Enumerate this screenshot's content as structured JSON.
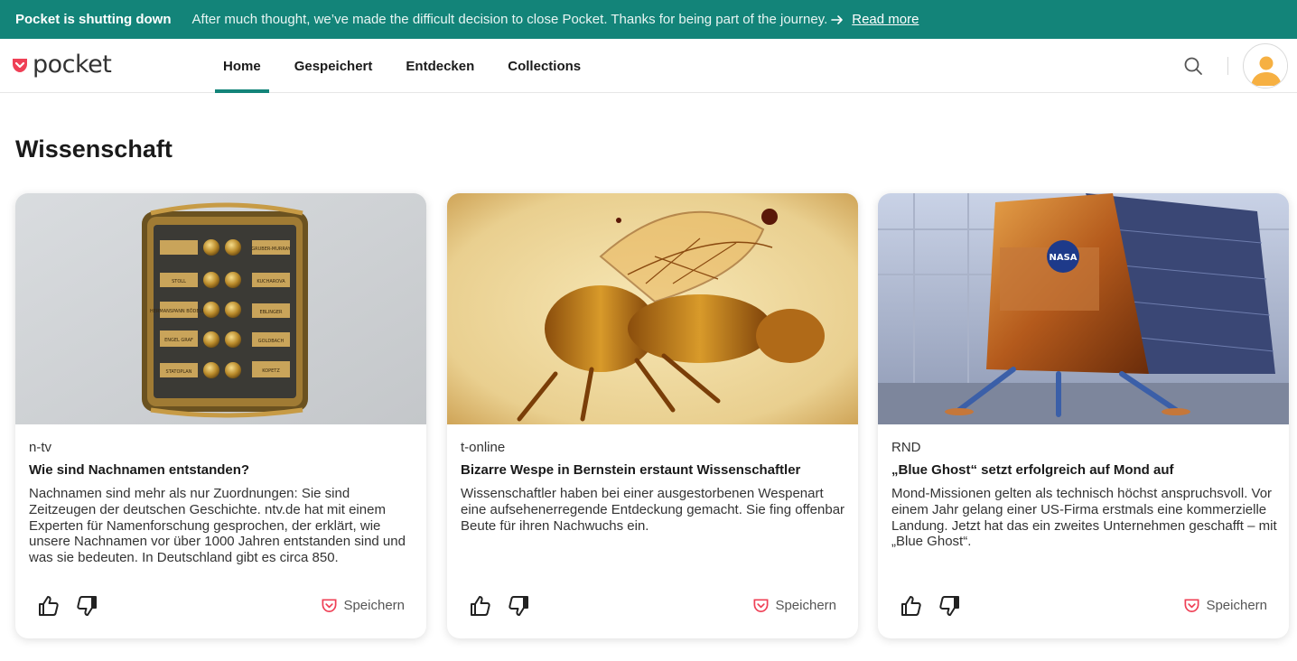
{
  "banner": {
    "title": "Pocket is shutting down",
    "message": "After much thought, we’ve made the difficult decision to close Pocket. Thanks for being part of the journey.",
    "link": "Read more"
  },
  "header": {
    "logo_text": "pocket",
    "tabs": [
      {
        "label": "Home",
        "active": true
      },
      {
        "label": "Gespeichert",
        "active": false
      },
      {
        "label": "Entdecken",
        "active": false
      },
      {
        "label": "Collections",
        "active": false
      }
    ],
    "icons": {
      "search": "search-icon",
      "avatar": "user-avatar-icon"
    }
  },
  "section": {
    "title": "Wissenschaft"
  },
  "cards": [
    {
      "source": "n-tv",
      "title": "Wie sind Nachnamen entstanden?",
      "description": "Nachnamen sind mehr als nur Zuordnungen: Sie sind Zeitzeugen der deutschen Geschichte. ntv.de hat mit einem Experten für Namenforschung gesprochen, der erklärt, wie unsere Nachnamen vor über 1000 Jahren entstanden sind und was sie bedeuten. In Deutschland gibt es circa 850.",
      "save_label": "Speichern",
      "image": "doorbell-nameplate-photo",
      "nameplates": [
        "",
        "GRUBER-MURRAY",
        "STOLL",
        "KUCHAROVA",
        "HERMANSPANN BÖDELER",
        "EBLINGER",
        "ENGEL GRAF",
        "GOLDBACH",
        "STATOPLAN",
        "KOPETZ"
      ]
    },
    {
      "source": "t-online",
      "title": "Bizarre Wespe in Bernstein erstaunt Wissenschaftler",
      "description": "Wissenschaftler haben bei einer ausgestorbenen Wespenart eine aufsehenerregende Entdeckung gemacht. Sie fing offenbar Beute für ihren Nachwuchs ein.",
      "save_label": "Speichern",
      "image": "wasp-in-amber-photo"
    },
    {
      "source": "RND",
      "title": "„Blue Ghost“ setzt erfolgreich auf Mond auf",
      "description": "Mond-Missionen gelten als technisch höchst anspruchsvoll. Vor einem Jahr gelang einer US-Firma erstmals eine kommerzielle Landung. Jetzt hat das ein zweites Unternehmen geschafft – mit „Blue Ghost“.",
      "save_label": "Speichern",
      "image": "lunar-lander-photo",
      "logo_text": "NASA"
    }
  ],
  "colors": {
    "accent": "#138479",
    "brand": "#ef4056"
  }
}
